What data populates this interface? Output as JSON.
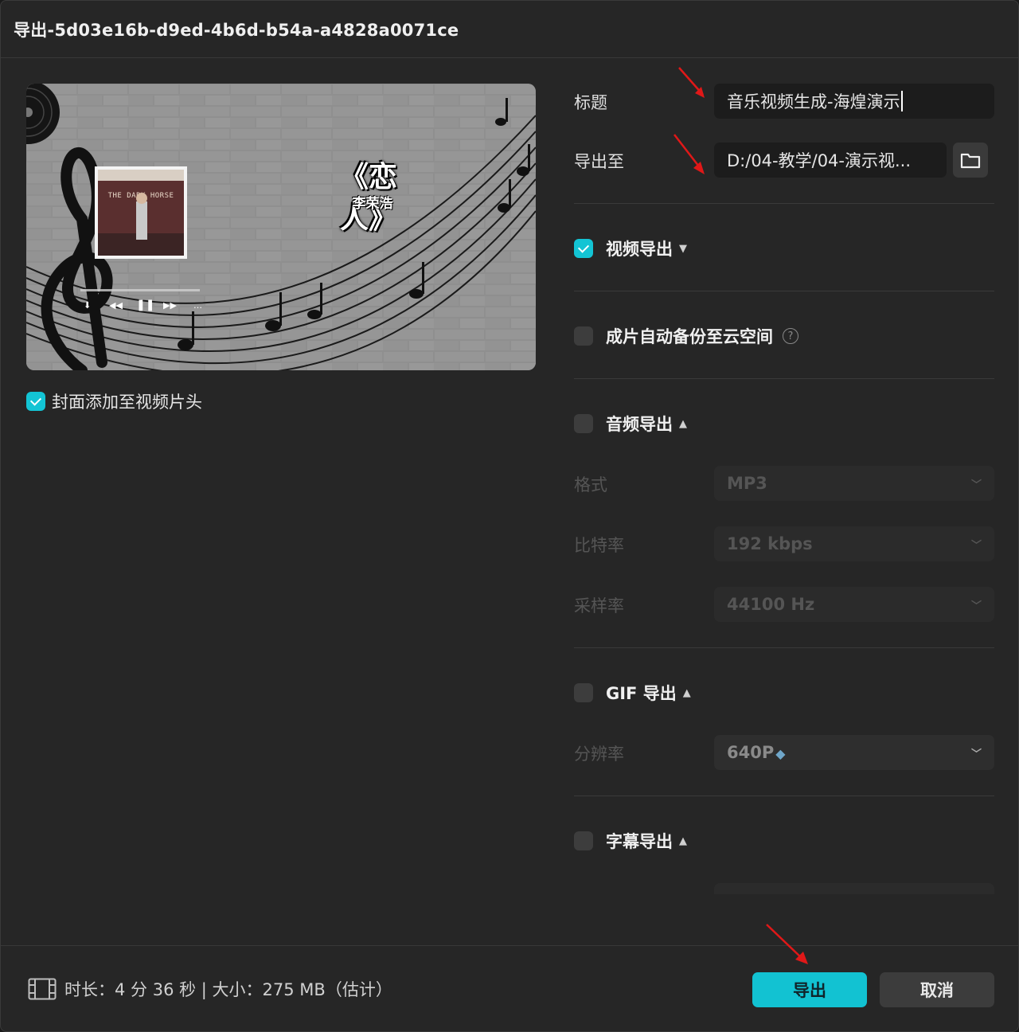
{
  "window": {
    "title": "导出-5d03e16b-d9ed-4b6d-b54a-a4828a0071ce"
  },
  "preview": {
    "song_title": "《恋人》",
    "song_artist": "李荣浩",
    "album_art_text": "THE DARK HORSE",
    "cover_checkbox_checked": true,
    "cover_checkbox_label": "封面添加至视频片头"
  },
  "form": {
    "title_label": "标题",
    "title_value": "音乐视频生成-海煌演示",
    "export_to_label": "导出至",
    "export_to_value": "D:/04-教学/04-演示视..."
  },
  "sections": {
    "video": {
      "label": "视频导出",
      "checked": true,
      "arrow": "down"
    },
    "backup": {
      "label": "成片自动备份至云空间",
      "checked": false,
      "help": "?"
    },
    "audio": {
      "label": "音频导出",
      "checked": false,
      "arrow": "up",
      "format_label": "格式",
      "format_value": "MP3",
      "bitrate_label": "比特率",
      "bitrate_value": "192 kbps",
      "samplerate_label": "采样率",
      "samplerate_value": "44100 Hz"
    },
    "gif": {
      "label": "GIF 导出",
      "checked": false,
      "arrow": "up",
      "resolution_label": "分辨率",
      "resolution_value": "640P"
    },
    "subtitle": {
      "label": "字幕导出",
      "checked": false,
      "arrow": "up"
    }
  },
  "footer": {
    "info": "时长：4 分 36 秒 | 大小：275 MB（估计）",
    "export_button": "导出",
    "cancel_button": "取消"
  },
  "colors": {
    "accent": "#12c2d2",
    "background": "#262626",
    "annotation_arrow": "#e01818"
  },
  "icons": {
    "folder": "folder-icon",
    "film": "film-icon",
    "chevron": "chevron-down-icon",
    "help": "help-circle-icon",
    "gem": "diamond-icon"
  }
}
